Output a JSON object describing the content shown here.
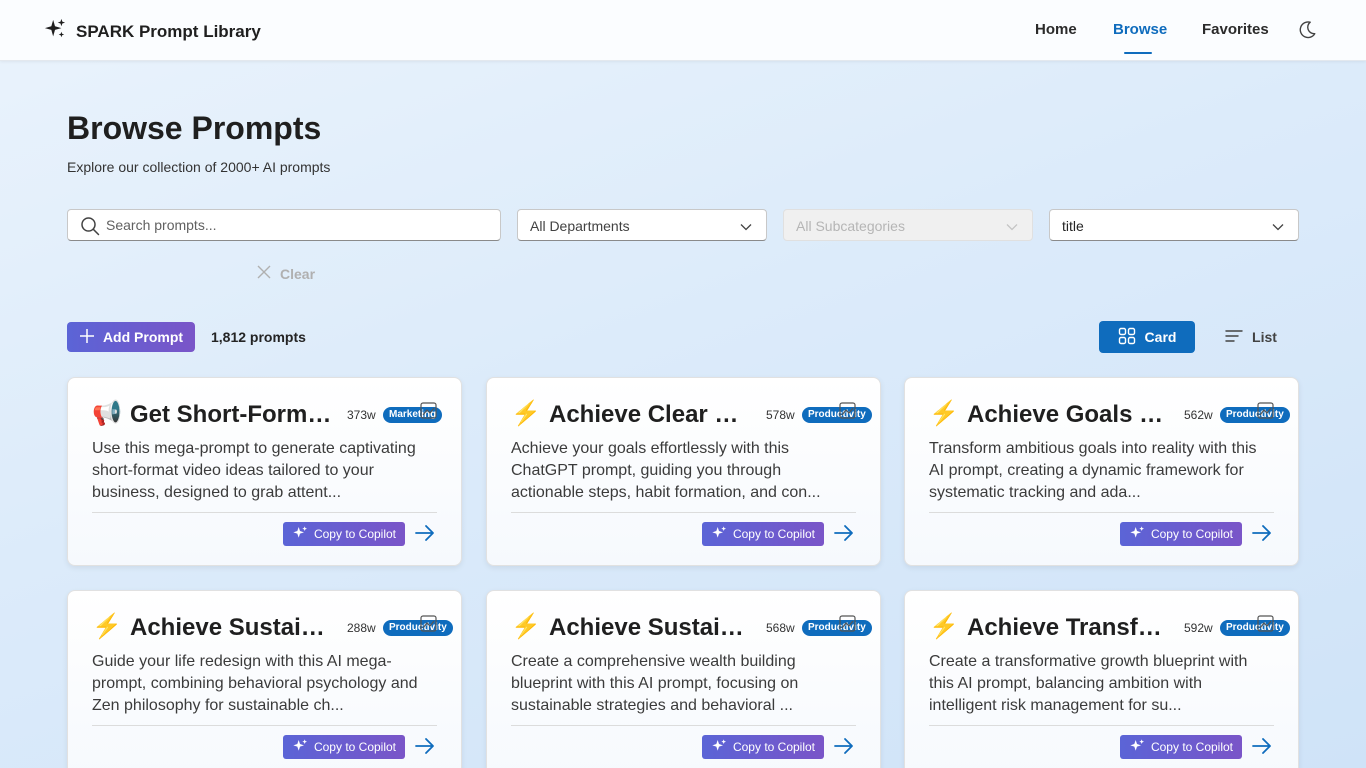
{
  "header": {
    "brand": "SPARK Prompt Library",
    "nav": [
      {
        "label": "Home",
        "active": false
      },
      {
        "label": "Browse",
        "active": true
      },
      {
        "label": "Favorites",
        "active": false
      }
    ],
    "theme_icon": "moon-icon",
    "accent": "#0f6cbd"
  },
  "page": {
    "title": "Browse Prompts",
    "subtitle": "Explore our collection of 2000+ AI prompts"
  },
  "filters": {
    "search_placeholder": "Search prompts...",
    "search_value": "",
    "department": "All Departments",
    "subcategory": "All Subcategories",
    "sort": "title",
    "clear_label": "Clear"
  },
  "toolbar": {
    "add_label": "Add Prompt",
    "count": "1,812 prompts",
    "card_label": "Card",
    "list_label": "List",
    "view_mode": "card"
  },
  "cards": [
    {
      "emoji": "📢",
      "title": "Get Short-Form Video Ideas",
      "words": "373w",
      "category": "Marketing",
      "description": "Use this mega-prompt to generate captivating short-format video ideas tailored to your business, designed to grab attent...",
      "copy_label": "Copy to Copilot"
    },
    {
      "emoji": "⚡",
      "title": "Achieve Clear Goals",
      "words": "578w",
      "category": "Productivity",
      "description": "Achieve your goals effortlessly with this ChatGPT prompt, guiding you through actionable steps, habit formation, and con...",
      "copy_label": "Copy to Copilot"
    },
    {
      "emoji": "⚡",
      "title": "Achieve Goals Systematically",
      "words": "562w",
      "category": "Productivity",
      "description": "Transform ambitious goals into reality with this AI prompt, creating a dynamic framework for systematic tracking and ada...",
      "copy_label": "Copy to Copilot"
    },
    {
      "emoji": "⚡",
      "title": "Achieve Sustainable Change",
      "words": "288w",
      "category": "Productivity",
      "description": "Guide your life redesign with this AI mega-prompt, combining behavioral psychology and Zen philosophy for sustainable ch...",
      "copy_label": "Copy to Copilot"
    },
    {
      "emoji": "⚡",
      "title": "Achieve Sustainable Wealth",
      "words": "568w",
      "category": "Productivity",
      "description": "Create a comprehensive wealth building blueprint with this AI prompt, focusing on sustainable strategies and behavioral ...",
      "copy_label": "Copy to Copilot"
    },
    {
      "emoji": "⚡",
      "title": "Achieve Transformative Growth",
      "words": "592w",
      "category": "Productivity",
      "description": "Create a transformative growth blueprint with this AI prompt, balancing ambition with intelligent risk management for su...",
      "copy_label": "Copy to Copilot"
    }
  ]
}
